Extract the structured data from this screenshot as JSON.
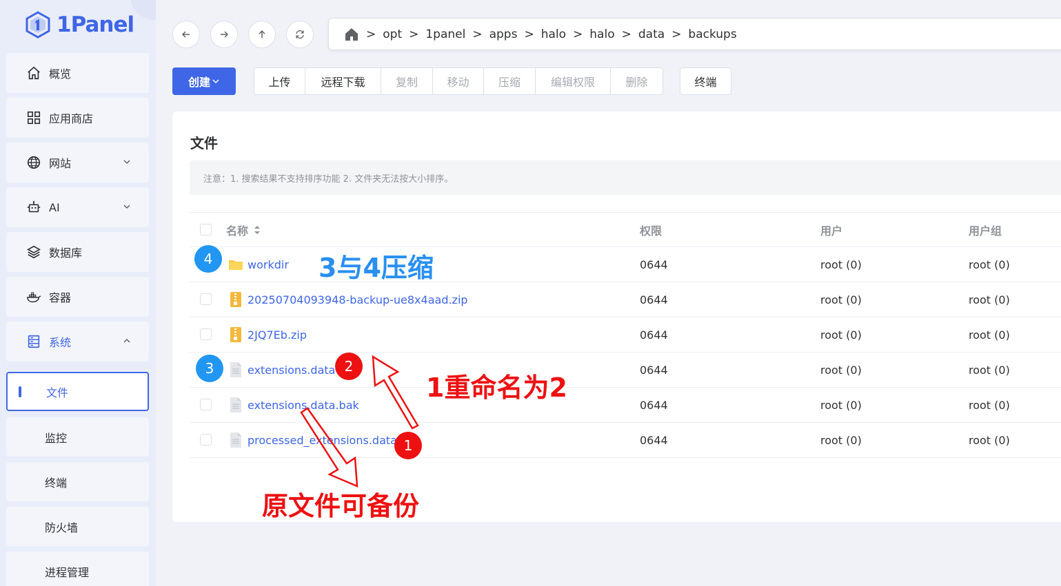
{
  "app": {
    "logo_text": "1Panel"
  },
  "sidebar": {
    "items": [
      {
        "label": "概览",
        "icon": "home-icon"
      },
      {
        "label": "应用商店",
        "icon": "grid-icon"
      },
      {
        "label": "网站",
        "icon": "globe-icon"
      },
      {
        "label": "AI",
        "icon": "robot-icon"
      },
      {
        "label": "数据库",
        "icon": "layers-icon"
      },
      {
        "label": "容器",
        "icon": "docker-icon"
      },
      {
        "label": "系统",
        "icon": "server-icon"
      }
    ],
    "sub_items": [
      "文件",
      "监控",
      "终端",
      "防火墙",
      "进程管理"
    ]
  },
  "breadcrumb": {
    "items": [
      "opt",
      "1panel",
      "apps",
      "halo",
      "halo",
      "data",
      "backups"
    ],
    "separator": ">"
  },
  "toolbar": {
    "create_label": "创建",
    "group": [
      {
        "label": "上传",
        "enabled": true
      },
      {
        "label": "远程下载",
        "enabled": true
      },
      {
        "label": "复制",
        "enabled": false
      },
      {
        "label": "移动",
        "enabled": false
      },
      {
        "label": "压缩",
        "enabled": false
      },
      {
        "label": "编辑权限",
        "enabled": false
      },
      {
        "label": "删除",
        "enabled": false
      }
    ],
    "terminal_label": "终端"
  },
  "files": {
    "title": "文件",
    "notice": "注意：1. 搜索结果不支持排序功能 2. 文件夹无法按大小排序。",
    "columns": {
      "name": "名称",
      "permission": "权限",
      "user": "用户",
      "group": "用户组"
    },
    "rows": [
      {
        "name": "workdir",
        "type": "folder",
        "permission": "0644",
        "user": "root (0)",
        "group": "root (0)"
      },
      {
        "name": "20250704093948-backup-ue8x4aad.zip",
        "type": "zip",
        "permission": "0644",
        "user": "root (0)",
        "group": "root (0)"
      },
      {
        "name": "2JQ7Eb.zip",
        "type": "zip",
        "permission": "0644",
        "user": "root (0)",
        "group": "root (0)"
      },
      {
        "name": "extensions.data",
        "type": "file",
        "permission": "0644",
        "user": "root (0)",
        "group": "root (0)"
      },
      {
        "name": "extensions.data.bak",
        "type": "file",
        "permission": "0644",
        "user": "root (0)",
        "group": "root (0)"
      },
      {
        "name": "processed_extensions.data",
        "type": "file",
        "permission": "0644",
        "user": "root (0)",
        "group": "root (0)"
      }
    ]
  },
  "annotations": {
    "badge_4": "4",
    "badge_3": "3",
    "badge_2": "2",
    "badge_1": "1",
    "compress_note": "3与4压缩",
    "rename_note": "1重命名为2",
    "backup_note": "原文件可备份",
    "colors": {
      "blue": "#2196f3",
      "red": "#ee1111"
    }
  }
}
